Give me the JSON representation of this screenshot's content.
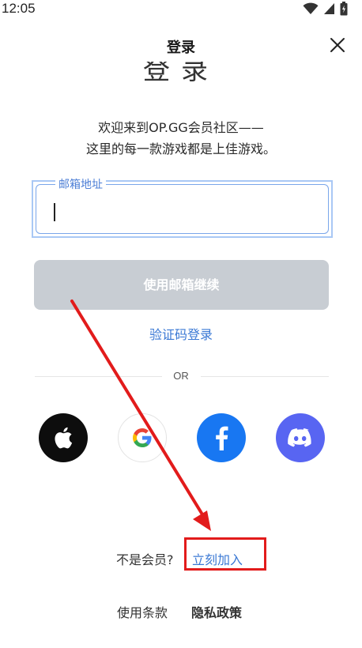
{
  "status_bar": {
    "time": "12:05"
  },
  "header": {
    "title": "登录"
  },
  "clipped_heading": "登录",
  "welcome": {
    "line1": "欢迎来到OP.GG会员社区——",
    "line2": "这里的每一款游戏都是上佳游戏。"
  },
  "email": {
    "label": "邮箱地址",
    "value": "",
    "placeholder": ""
  },
  "continue_button": "使用邮箱继续",
  "code_login": "验证码登录",
  "divider_text": "OR",
  "social": [
    {
      "name": "Apple",
      "icon": "apple-icon",
      "color": "#0d0d0d"
    },
    {
      "name": "Google",
      "icon": "google-icon",
      "color": "#ffffff"
    },
    {
      "name": "Facebook",
      "icon": "facebook-icon",
      "color": "#1877f2"
    },
    {
      "name": "Discord",
      "icon": "discord-icon",
      "color": "#5865f2"
    }
  ],
  "join": {
    "prompt": "不是会员?",
    "link": "立刻加入"
  },
  "footer": {
    "terms": "使用条款",
    "privacy": "隐私政策"
  },
  "colors": {
    "accent": "#3a78d4",
    "annotation": "#e21b1b",
    "button_disabled": "#c8cdd3"
  }
}
